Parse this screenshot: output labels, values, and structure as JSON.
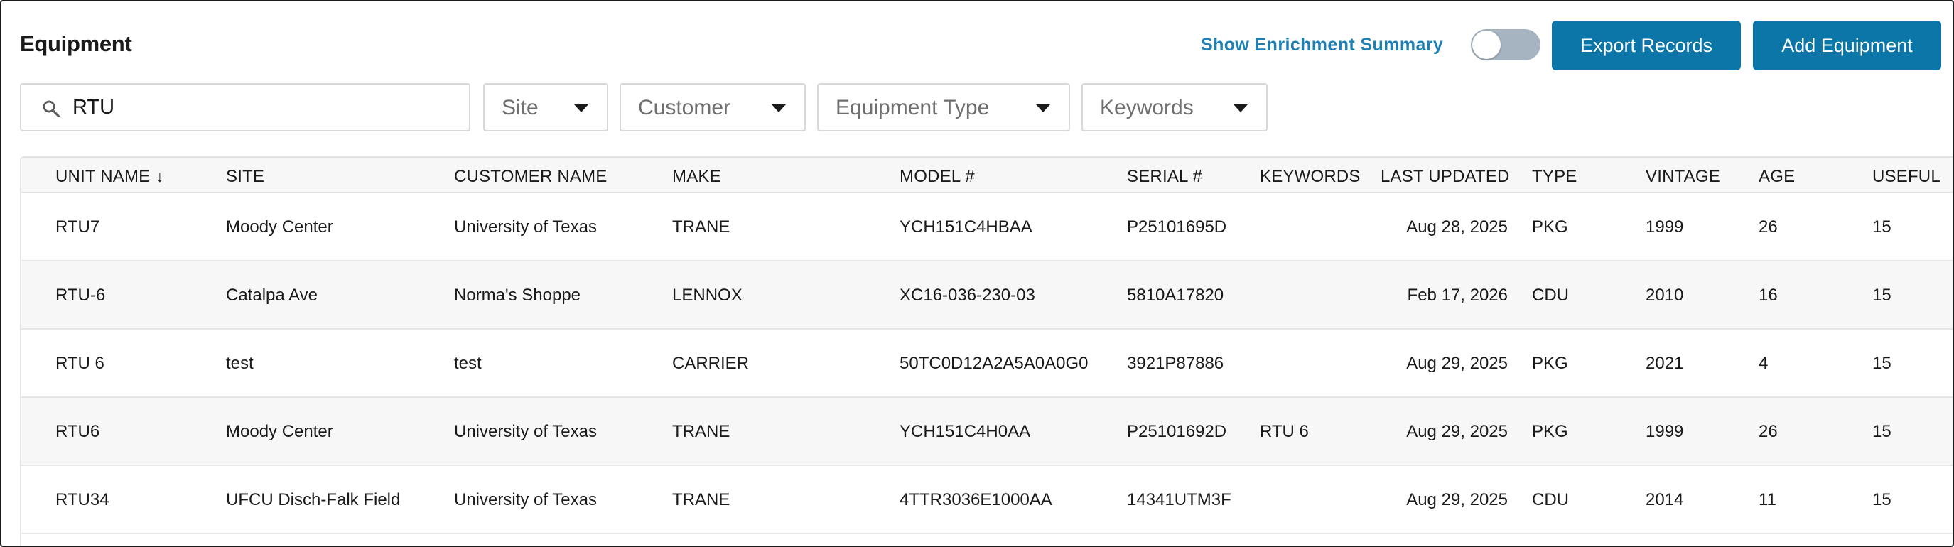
{
  "header": {
    "title": "Equipment",
    "enrichment_link": "Show Enrichment Summary",
    "export_label": "Export Records",
    "add_label": "Add Equipment"
  },
  "filters": {
    "search_value": "RTU",
    "site": "Site",
    "customer": "Customer",
    "equipment_type": "Equipment Type",
    "keywords": "Keywords"
  },
  "table": {
    "columns": [
      "UNIT NAME",
      "SITE",
      "CUSTOMER NAME",
      "MAKE",
      "MODEL #",
      "SERIAL #",
      "KEYWORDS",
      "LAST UPDATED",
      "TYPE",
      "VINTAGE",
      "AGE",
      "USEFUL"
    ],
    "sort_indicator": "↓",
    "rows": [
      [
        "RTU7",
        "Moody Center",
        "University of Texas",
        "TRANE",
        "YCH151C4HBAA",
        "P25101695D",
        "",
        "Aug 28, 2025",
        "PKG",
        "1999",
        "26",
        "15"
      ],
      [
        "RTU-6",
        "Catalpa Ave",
        "Norma's Shoppe",
        "LENNOX",
        "XC16-036-230-03",
        "5810A17820",
        "",
        "Feb 17, 2026",
        "CDU",
        "2010",
        "16",
        "15"
      ],
      [
        "RTU 6",
        "test",
        "test",
        "CARRIER",
        "50TC0D12A2A5A0A0G0",
        "3921P87886",
        "",
        "Aug 29, 2025",
        "PKG",
        "2021",
        "4",
        "15"
      ],
      [
        "RTU6",
        "Moody Center",
        "University of Texas",
        "TRANE",
        "YCH151C4H0AA",
        "P25101692D",
        "RTU 6",
        "Aug 29, 2025",
        "PKG",
        "1999",
        "26",
        "15"
      ],
      [
        "RTU34",
        "UFCU Disch-Falk Field",
        "University of Texas",
        "TRANE",
        "4TTR3036E1000AA",
        "14341UTM3F",
        "",
        "Aug 29, 2025",
        "CDU",
        "2014",
        "11",
        "15"
      ]
    ]
  },
  "colors": {
    "primary": "#0c76a8",
    "link": "#1d7fb3",
    "toggle_off": "#a6b4c2"
  },
  "icons": [
    "search-icon",
    "chevron-down-icon",
    "sort-down-arrow-icon"
  ]
}
